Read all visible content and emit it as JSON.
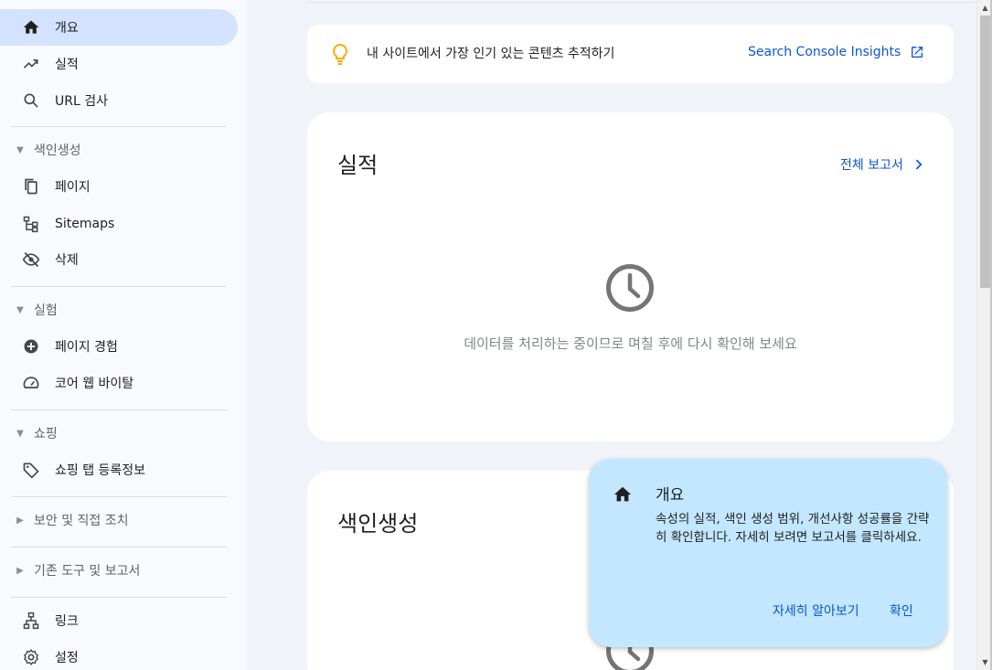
{
  "sidebar": {
    "items": [
      {
        "label": "개요",
        "icon": "home-icon"
      },
      {
        "label": "실적",
        "icon": "trending-up-icon"
      },
      {
        "label": "URL 검사",
        "icon": "search-icon"
      }
    ],
    "sections": [
      {
        "label": "색인생성",
        "items": [
          {
            "label": "페이지",
            "icon": "pages-icon"
          },
          {
            "label": "Sitemaps",
            "icon": "sitemap-icon"
          },
          {
            "label": "삭제",
            "icon": "eye-off-icon"
          }
        ]
      },
      {
        "label": "실험",
        "items": [
          {
            "label": "페이지 경험",
            "icon": "plus-circle-icon"
          },
          {
            "label": "코어 웹 바이탈",
            "icon": "speed-gauge-icon"
          }
        ]
      },
      {
        "label": "쇼핑",
        "items": [
          {
            "label": "쇼핑 탭 등록정보",
            "icon": "tag-icon"
          }
        ]
      },
      {
        "label": "보안 및 직접 조치"
      },
      {
        "label": "기존 도구 및 보고서"
      }
    ],
    "bottom": [
      {
        "label": "링크",
        "icon": "links-icon"
      },
      {
        "label": "설정",
        "icon": "gear-icon"
      }
    ]
  },
  "insights": {
    "text": "내 사이트에서 가장 인기 있는 콘텐츠 추적하기",
    "link": "Search Console Insights",
    "accent": "#f9ab00"
  },
  "performance": {
    "title": "실적",
    "full_report": "전체 보고서",
    "message": "데이터를 처리하는 중이므로 며칠 후에 다시 확인해 보세요"
  },
  "indexing": {
    "title": "색인생성"
  },
  "tooltip": {
    "title": "개요",
    "body": "속성의 실적, 색인 생성 범위, 개선사항 성공률을 간략히 확인합니다. 자세히 보려면 보고서를 클릭하세요.",
    "learn_more": "자세히 알아보기",
    "ok": "확인",
    "background": "#c2e7ff"
  },
  "colors": {
    "link": "#0b57d0",
    "active_nav": "#d3e3fd"
  }
}
